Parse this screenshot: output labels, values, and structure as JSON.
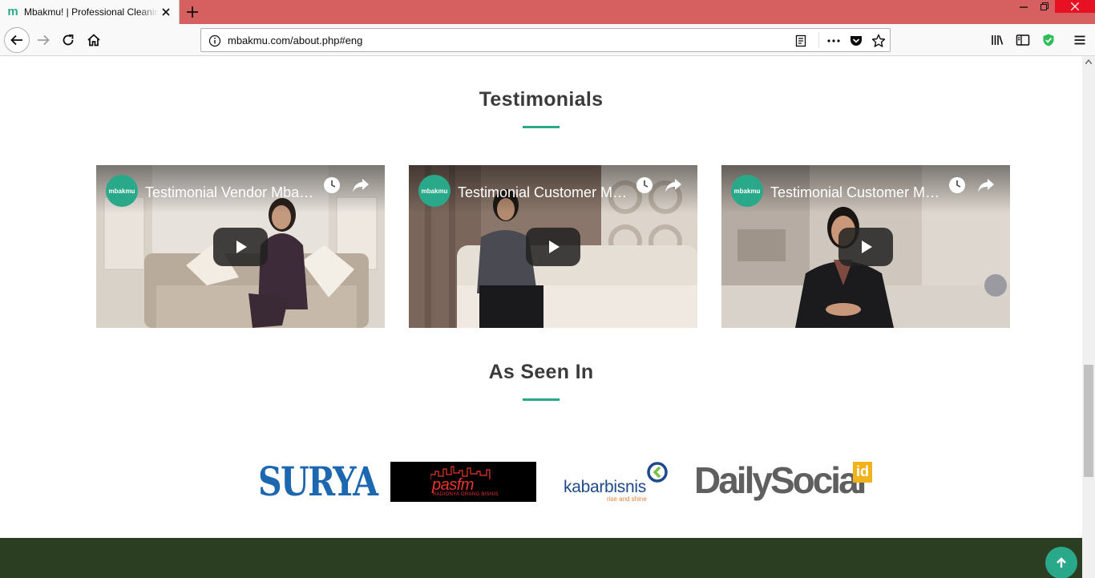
{
  "browser": {
    "tab_title": "Mbakmu! | Professional Cleaning",
    "favicon_letter": "m",
    "url": "mbakmu.com/about.php#eng"
  },
  "icons": {
    "back": "arrow-left-icon",
    "forward": "arrow-right-icon",
    "reload": "reload-icon",
    "home": "home-icon",
    "reader": "reader-view-icon",
    "more": "more-dots-icon",
    "pocket": "pocket-icon",
    "bookmark": "star-icon",
    "library": "library-icon",
    "sidebar": "sidebar-icon",
    "shield": "shield-icon",
    "menu": "hamburger-icon"
  },
  "colors": {
    "accent": "#2aa88a",
    "tabbar": "#d5605f",
    "footer": "#2b3e22",
    "heading": "#3b3b3b"
  },
  "testimonials": {
    "title": "Testimonials",
    "videos": [
      {
        "title": "Testimonial Vendor Mbakmu",
        "channel": "mbakmu"
      },
      {
        "title": "Testimonial Customer Mbakmu",
        "channel": "mbakmu"
      },
      {
        "title": "Testimonial Customer Mbakmu",
        "channel": "mbakmu"
      }
    ]
  },
  "as_seen_in": {
    "title": "As Seen In",
    "logos": {
      "surya": "SURYA",
      "pasfm": {
        "name": "pasfm",
        "tagline": "RADIONYA ORANG BISNIS"
      },
      "kabarbisnis": {
        "name": "kabarbisnis",
        "tagline": "rise and shine"
      },
      "dailysocial": {
        "name": "DailySocial",
        "suffix": "id"
      }
    }
  }
}
